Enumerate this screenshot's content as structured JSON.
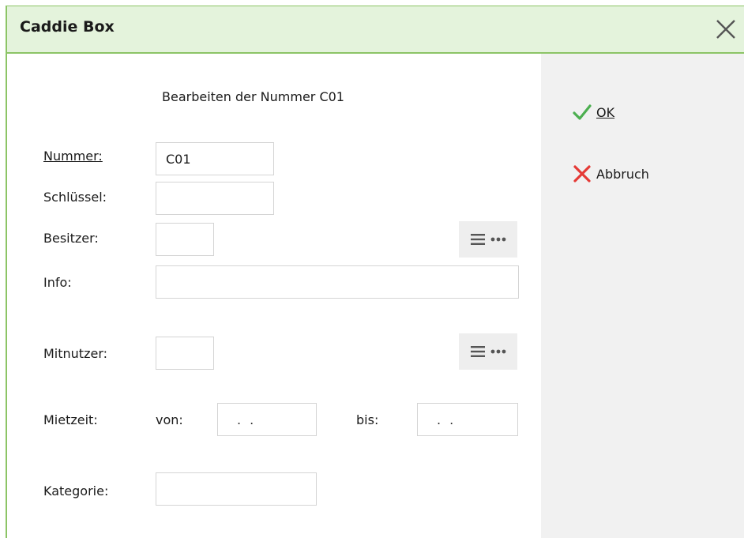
{
  "window": {
    "title": "Caddie Box"
  },
  "actions": {
    "ok": "OK",
    "cancel": "Abbruch"
  },
  "form": {
    "heading": "Bearbeiten der Nummer C01",
    "nummer": {
      "label": "Nummer:",
      "value": "C01"
    },
    "schluessel": {
      "label": "Schlüssel:",
      "value": ""
    },
    "besitzer": {
      "label": "Besitzer:",
      "value": ""
    },
    "info": {
      "label": "Info:",
      "value": ""
    },
    "mitnutzer": {
      "label": "Mitnutzer:",
      "value": ""
    },
    "mietzeit": {
      "label": "Mietzeit:",
      "von_label": "von:",
      "von_value": ". .",
      "bis_label": "bis:",
      "bis_value": ". ."
    },
    "kategorie": {
      "label": "Kategorie:",
      "value": ""
    }
  },
  "colors": {
    "title_bg": "#e4f3dc",
    "accent_border": "#8cc466",
    "ok_check": "#4caf50",
    "cancel_x": "#e53935",
    "side_panel": "#f1f1f1"
  },
  "icons": [
    "close-icon",
    "checkmark-icon",
    "cross-icon",
    "list-icon",
    "more-icon"
  ]
}
